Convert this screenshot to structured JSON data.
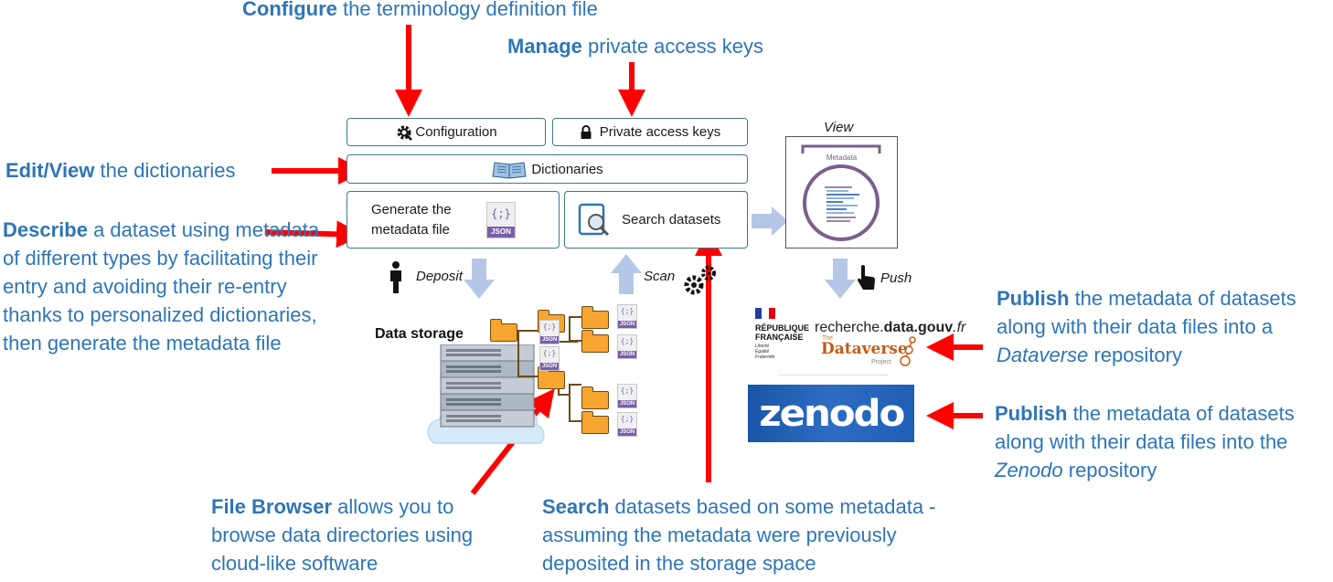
{
  "annotations": {
    "configure": {
      "bold": "Configure",
      "rest": " the terminology definition file"
    },
    "manage": {
      "bold": "Manage",
      "rest": " private access keys"
    },
    "edit": {
      "bold": "Edit/View",
      "rest": " the dictionaries"
    },
    "describe": {
      "bold": "Describe",
      "rest": " a dataset using metadata of different types by facilitating their entry and avoiding their re-entry thanks to personalized dictionaries, then generate the metadata file"
    },
    "file_browser": {
      "bold": "File Browser",
      "rest": " allows you to browse data directories using cloud-like software"
    },
    "search": {
      "bold": "Search",
      "rest": " datasets based on some metadata - assuming the metadata were previously deposited in the storage space"
    },
    "publish_dataverse": {
      "bold": "Publish",
      "rest": " the metadata of datasets along with their data files into a ",
      "italic": "Dataverse",
      "tail": " repository"
    },
    "publish_zenodo": {
      "bold": "Publish",
      "rest": " the metadata of datasets along with their data files into the ",
      "italic": "Zenodo",
      "tail": " repository"
    }
  },
  "boxes": {
    "configuration": "Configuration",
    "private_keys": "Private access keys",
    "dictionaries": "Dictionaries",
    "generate": "Generate the metadata file",
    "json_badge": "JSON",
    "json_braces": "{;}",
    "search": "Search datasets",
    "metadata_doc": "Metadata"
  },
  "labels": {
    "view": "View",
    "deposit": "Deposit",
    "scan": "Scan",
    "push": "Push",
    "data_storage": "Data storage"
  },
  "logos": {
    "republique": "RÉPUBLIQUE FRANÇAISE",
    "republique_motto": "Liberté Égalité Fraternité",
    "recherche_prefix": "recherche.",
    "recherche_bold": "data.gouv",
    "recherche_suffix": ".fr",
    "dataverse_the": "The",
    "dataverse_name": "Dataverse",
    "dataverse_project": "Project",
    "zenodo": "zenodo"
  },
  "colors": {
    "annotation_blue": "#2e75b6",
    "red_arrow": "#ff0000",
    "box_border": "#3b7a8c",
    "flow_arrow": "#b4c7e7",
    "metadata_purple": "#7a5e8c",
    "zenodo_blue": "#1f5fb5"
  },
  "icons": [
    "gear-icon",
    "lock-icon",
    "book-icon",
    "json-file-icon",
    "search-doc-icon",
    "person-icon",
    "cogs-icon",
    "hand-pointer-icon",
    "folder-icon",
    "server-icon",
    "cloud-icon"
  ]
}
